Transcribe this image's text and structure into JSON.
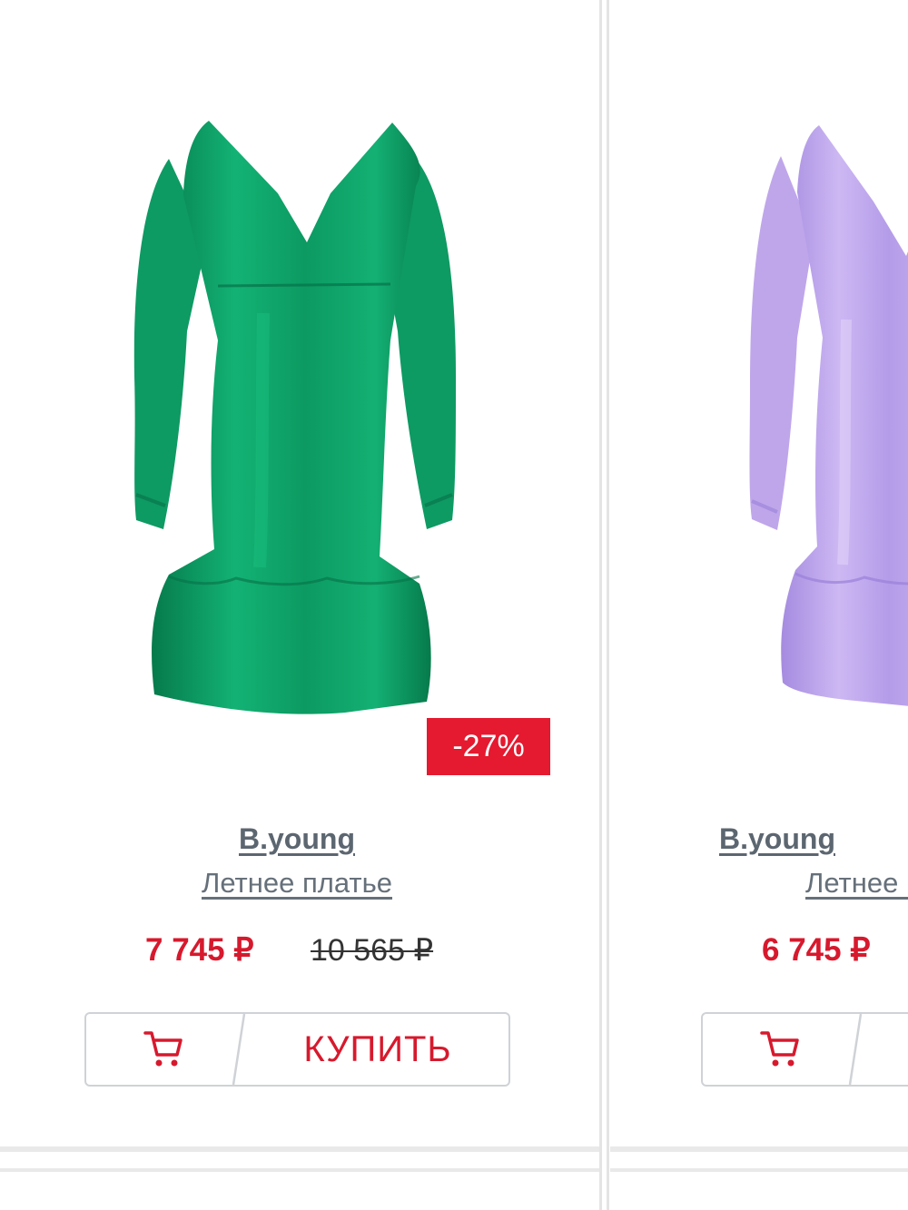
{
  "products": [
    {
      "brand": "B.young",
      "name": "Летнее платье",
      "price": "7 745 ₽",
      "old_price": "10 565 ₽",
      "discount": "-27%",
      "buy_label": "КУПИТЬ",
      "dress_color": "#0e9a63"
    },
    {
      "brand": "B.young",
      "name": "Летнее платье",
      "price": "6 745 ₽",
      "dress_color": "#bfa6ea"
    }
  ],
  "colors": {
    "accent_red": "#e5192f",
    "link_gray": "#5c6670",
    "border": "#cfd2d6"
  },
  "icons": {
    "cart": "shopping-cart-icon"
  }
}
